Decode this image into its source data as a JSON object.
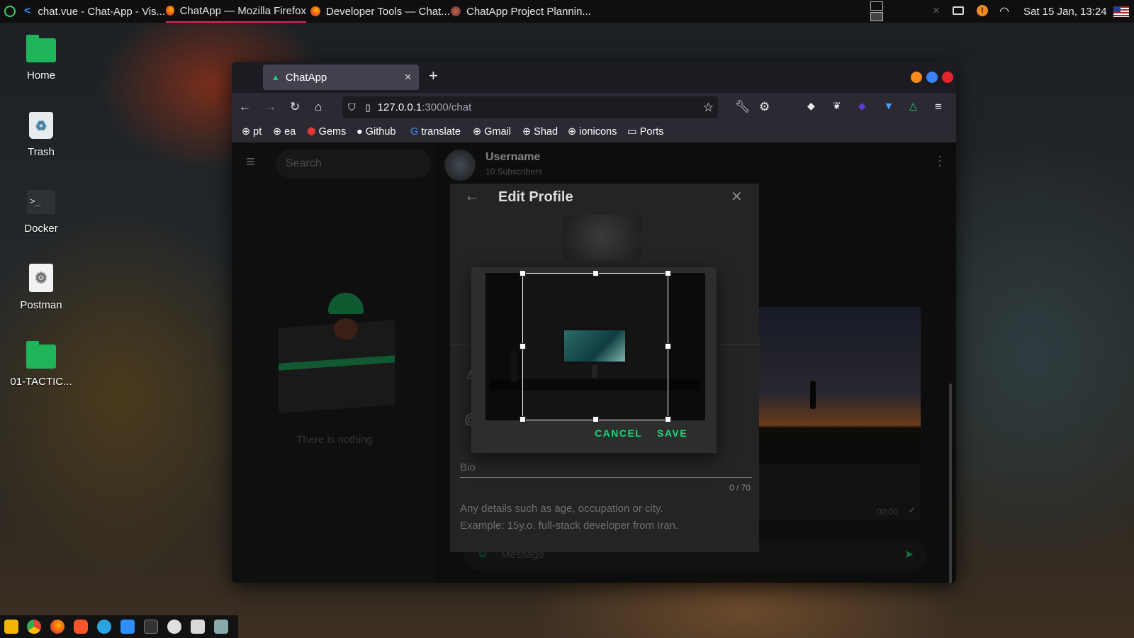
{
  "topbar": {
    "windows": [
      {
        "title": "chat.vue - Chat-App - Vis..."
      },
      {
        "title": "ChatApp — Mozilla Firefox"
      },
      {
        "title": "Developer Tools — Chat..."
      },
      {
        "title": "ChatApp Project Plannin..."
      }
    ],
    "clock": "Sat 15 Jan, 13:24"
  },
  "desktop": {
    "icons": [
      {
        "label": "Home"
      },
      {
        "label": "Trash"
      },
      {
        "label": "Docker"
      },
      {
        "label": "Postman"
      },
      {
        "label": "01-TACTIC..."
      }
    ]
  },
  "browser": {
    "tab_title": "ChatApp",
    "url_host": "127.0.0.1",
    "url_path": ":3000/chat",
    "bookmarks": [
      "pt",
      "ea",
      "Gems",
      "Github",
      "translate",
      "Gmail",
      "Shad",
      "ionicons",
      "Ports"
    ]
  },
  "app": {
    "search_placeholder": "Search",
    "empty_text": "There is nothing",
    "header_username": "Username",
    "header_subtitle": "10 Subscribers",
    "message_placeholder": "Message",
    "message_time": "00:00",
    "colors": {
      "accent": "#1fd47a",
      "surface": "#242424"
    }
  },
  "edit_profile": {
    "title": "Edit Profile",
    "bio_label": "Bio",
    "bio_counter": "0 / 70",
    "bio_hint_1": "Any details such as age, occupation or city.",
    "bio_hint_2": "Example: 15y.o. full-stack developer from Iran."
  },
  "crop_dialog": {
    "cancel_label": "CANCEL",
    "save_label": "SAVE"
  }
}
